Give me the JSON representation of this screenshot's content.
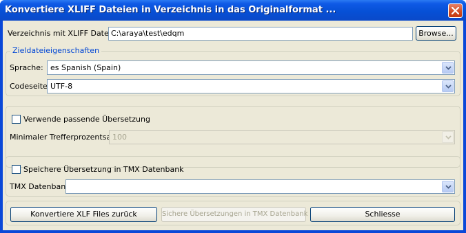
{
  "window": {
    "title": "Konvertiere XLIFF Dateien in Verzeichnis in das Originalformat ..."
  },
  "directory": {
    "label": "Verzeichnis mit XLIFF Dateien",
    "value": "C:\\araya\\test\\edqm",
    "browse_label": "Browse..."
  },
  "target_props": {
    "title": "Zieldateieigenschaften",
    "language_label": "Sprache:",
    "language_value": "es Spanish (Spain)",
    "codepage_label": "Codeseite",
    "codepage_value": "UTF-8"
  },
  "matching": {
    "checkbox_label": "Verwende passende Übersetzung",
    "checked": false,
    "min_label": "Minimaler Trefferprozentsatz",
    "min_value": "100"
  },
  "tmx": {
    "checkbox_label": "Speichere Übersetzung in TMX Datenbank",
    "checked": false,
    "db_label": "TMX Datenbank",
    "db_value": ""
  },
  "buttons": {
    "convert": "Konvertiere XLF Files zurück",
    "save_tmx": "Sichere Übersetzungen in TMX Datenbank",
    "close": "Schliesse"
  },
  "colors": {
    "titlebar": "#0650d6",
    "dialog_bg": "#ece9d8",
    "group_title": "#0046d5",
    "close_button": "#d04a20"
  }
}
